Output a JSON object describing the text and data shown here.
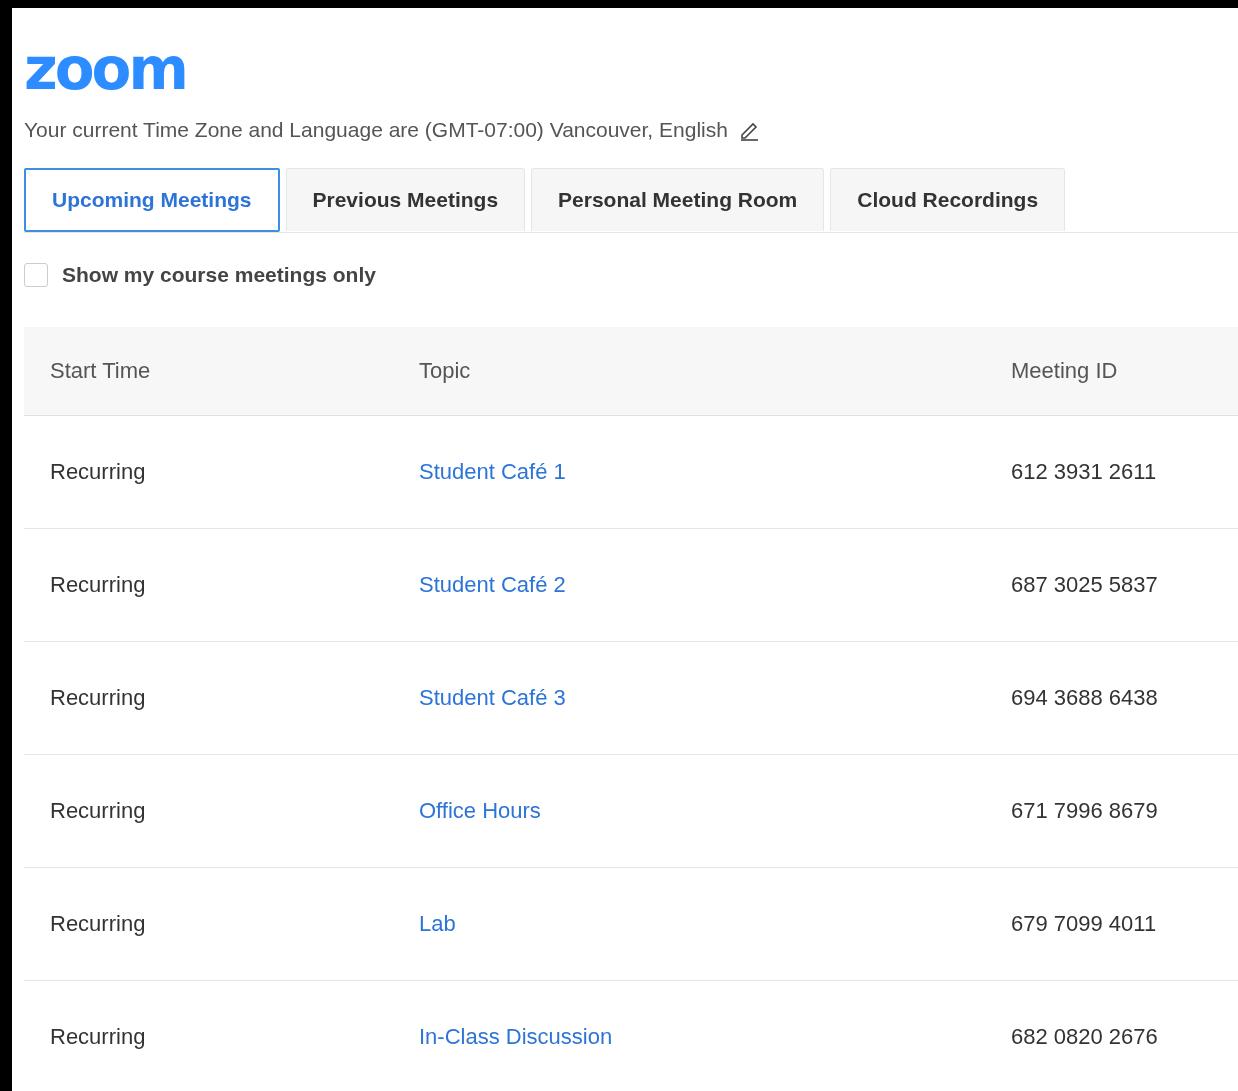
{
  "logo": {
    "text": "zoom"
  },
  "timezone_note": "Your current Time Zone and Language are (GMT-07:00) Vancouver, English",
  "tabs": [
    {
      "label": "Upcoming Meetings",
      "selected": true
    },
    {
      "label": "Previous Meetings",
      "selected": false
    },
    {
      "label": "Personal Meeting Room",
      "selected": false
    },
    {
      "label": "Cloud Recordings",
      "selected": false
    }
  ],
  "filter": {
    "label": "Show my course meetings only",
    "checked": false
  },
  "table": {
    "columns": [
      "Start Time",
      "Topic",
      "Meeting ID"
    ],
    "rows": [
      {
        "start_time": "Recurring",
        "topic": "Student Café 1",
        "meeting_id": "612 3931 2611"
      },
      {
        "start_time": "Recurring",
        "topic": "Student Café 2",
        "meeting_id": "687 3025 5837"
      },
      {
        "start_time": "Recurring",
        "topic": "Student Café 3",
        "meeting_id": "694 3688 6438"
      },
      {
        "start_time": "Recurring",
        "topic": "Office Hours",
        "meeting_id": "671 7996 8679"
      },
      {
        "start_time": "Recurring",
        "topic": "Lab",
        "meeting_id": "679 7099 4011"
      },
      {
        "start_time": "Recurring",
        "topic": "In-Class Discussion",
        "meeting_id": "682 0820 2676"
      }
    ]
  }
}
